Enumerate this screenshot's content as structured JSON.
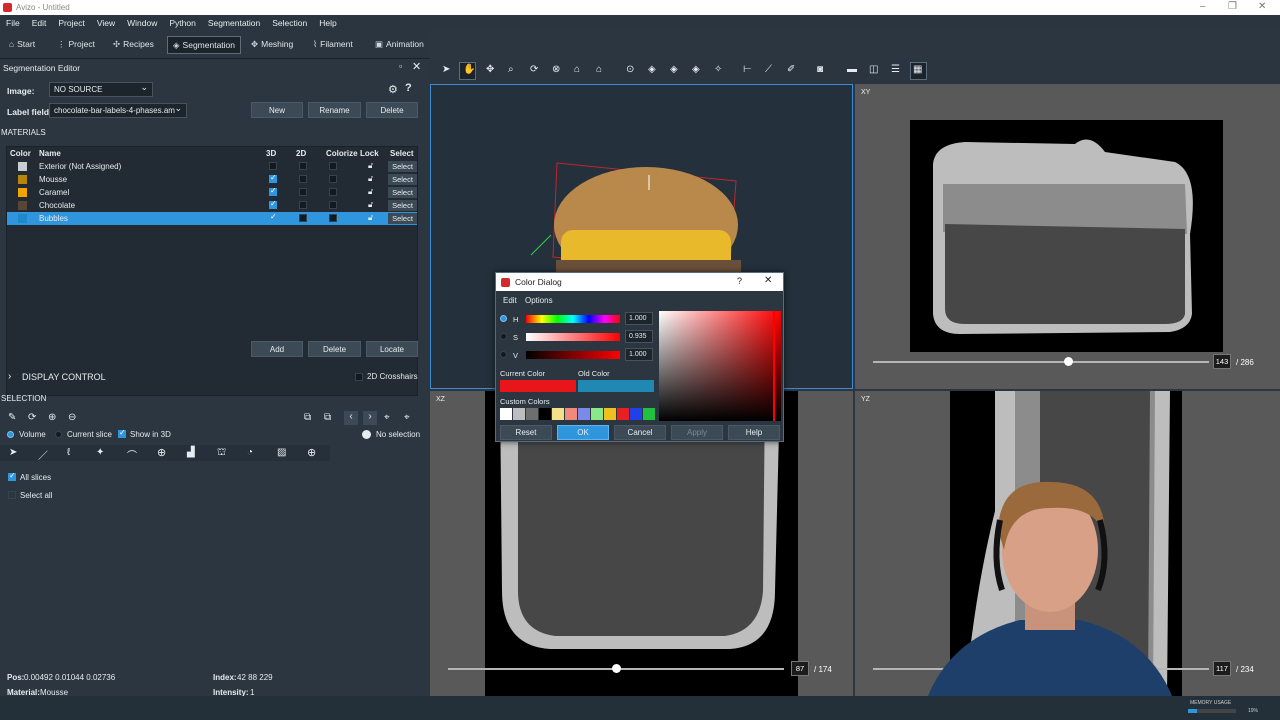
{
  "window": {
    "title": "Avizo - Untitled"
  },
  "menu": [
    "File",
    "Edit",
    "Project",
    "View",
    "Window",
    "Python",
    "Segmentation",
    "Selection",
    "Help"
  ],
  "modes": [
    {
      "icon": "home-icon",
      "glyph": "⌂",
      "label": "Start"
    },
    {
      "icon": "project-icon",
      "glyph": "⋮",
      "label": "Project"
    },
    {
      "icon": "recipes-icon",
      "glyph": "✣",
      "label": "Recipes"
    },
    {
      "icon": "segmentation-icon",
      "glyph": "◈",
      "label": "Segmentation"
    },
    {
      "icon": "meshing-icon",
      "glyph": "✥",
      "label": "Meshing"
    },
    {
      "icon": "filament-icon",
      "glyph": "⌇",
      "label": "Filament"
    },
    {
      "icon": "animation-icon",
      "glyph": "▣",
      "label": "Animation"
    }
  ],
  "segmentation_editor": {
    "title": "Segmentation Editor",
    "image_label": "Image:",
    "image_value": "NO SOURCE",
    "label_field_label": "Label field:",
    "label_field_value": "chocolate-bar-labels-4-phases.am",
    "new_label": "New",
    "rename_label": "Rename",
    "delete_label": "Delete",
    "materials_title": "MATERIALS",
    "columns": {
      "color": "Color",
      "name": "Name",
      "d3": "3D",
      "d2": "2D",
      "colorize": "Colorize",
      "lock": "Lock",
      "select": "Select"
    },
    "materials": [
      {
        "name": "Exterior (Not Assigned)",
        "color": "#c8cdd0",
        "d3": false,
        "d2": false,
        "select": "Select"
      },
      {
        "name": "Mousse",
        "color": "#b8860b",
        "d3": true,
        "d2": false,
        "select": "Select"
      },
      {
        "name": "Caramel",
        "color": "#f0a500",
        "d3": true,
        "d2": false,
        "select": "Select"
      },
      {
        "name": "Chocolate",
        "color": "#5a4634",
        "d3": true,
        "d2": false,
        "select": "Select"
      },
      {
        "name": "Bubbles",
        "color": "#1e88c8",
        "d3": true,
        "d2": false,
        "select": "Select",
        "selected": true
      }
    ],
    "add_label": "Add",
    "delete2_label": "Delete",
    "locate_label": "Locate",
    "display_control": "DISPLAY CONTROL",
    "crosshairs_label": "2D Crosshairs",
    "selection_title": "SELECTION",
    "volume_label": "Volume",
    "current_slice_label": "Current slice",
    "show3d_label": "Show in 3D",
    "no_selection_label": "No selection",
    "all_slices_label": "All slices",
    "select_all_label": "Select all"
  },
  "status": {
    "pos_label": "Pos:",
    "pos_value": "0.00492 0.01044 0.02736",
    "index_label": "Index:",
    "index_value": "42 88 229",
    "material_label": "Material:",
    "material_value": "Mousse",
    "intensity_label": "Intensity:",
    "intensity_value": "1"
  },
  "views": {
    "xy": {
      "label": "XY",
      "slice": "143",
      "total": "286",
      "slider": 0.58
    },
    "xz": {
      "label": "XZ",
      "slice": "87",
      "total": "174",
      "slider": 0.5
    },
    "yz": {
      "label": "YZ",
      "slice": "117",
      "total": "234",
      "slider": 0.5
    }
  },
  "color_dialog": {
    "title": "Color Dialog",
    "help_glyph": "?",
    "close_glyph": "✕",
    "menu": [
      "Edit",
      "Options"
    ],
    "h_label": "H",
    "h_value": "1.000",
    "s_label": "S",
    "s_value": "0.935",
    "v_label": "V",
    "v_value": "1.000",
    "current_color_label": "Current Color",
    "old_color_label": "Old Color",
    "current_color": "#e8161a",
    "old_color": "#1f88b3",
    "custom_colors_label": "Custom Colors",
    "custom_colors": [
      "#ffffff",
      "#bdbdbd",
      "#6e6e6e",
      "#000000",
      "#f2e08a",
      "#f08a7a",
      "#7a8ae8",
      "#8ae88a",
      "#f0c020",
      "#e82020",
      "#2040e8",
      "#20c040"
    ],
    "buttons": {
      "reset": "Reset",
      "ok": "OK",
      "cancel": "Cancel",
      "apply": "Apply",
      "help": "Help"
    }
  },
  "taskbar": {
    "memory_label": "MEMORY USAGE",
    "memory_value": "19%"
  }
}
